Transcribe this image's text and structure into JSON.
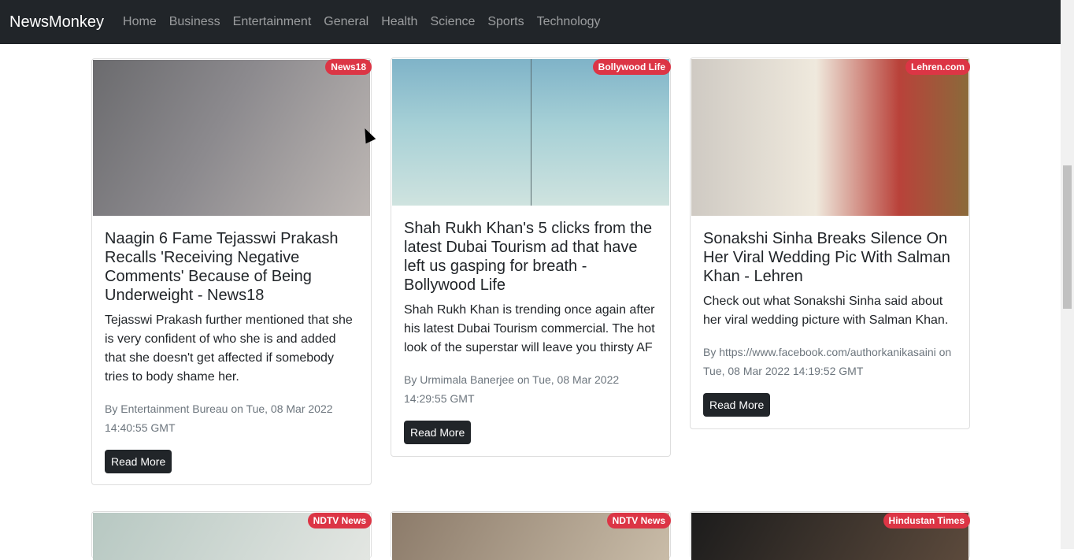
{
  "navbar": {
    "brand": "NewsMonkey",
    "links": [
      "Home",
      "Business",
      "Entertainment",
      "General",
      "Health",
      "Science",
      "Sports",
      "Technology"
    ]
  },
  "cards": [
    {
      "source": "News18",
      "title": "Naagin 6 Fame Tejasswi Prakash Recalls 'Receiving Negative Comments' Because of Being Underweight - News18",
      "description": "Tejasswi Prakash further mentioned that she is very confident of who she is and added that she doesn't get affected if somebody tries to body shame her.",
      "by_label": "By",
      "author": "Entertainment Bureau",
      "on_label": "on",
      "date": "Tue, 08 Mar 2022 14:40:55 GMT",
      "button": "Read More"
    },
    {
      "source": "Bollywood Life",
      "title": "Shah Rukh Khan's 5 clicks from the latest Dubai Tourism ad that have left us gasping for breath - Bollywood Life",
      "description": "Shah Rukh Khan is trending once again after his latest Dubai Tourism commercial. The hot look of the superstar will leave you thirsty AF",
      "by_label": "By",
      "author": "Urmimala Banerjee",
      "on_label": "on",
      "date": "Tue, 08 Mar 2022 14:29:55 GMT",
      "button": "Read More"
    },
    {
      "source": "Lehren.com",
      "title": "Sonakshi Sinha Breaks Silence On Her Viral Wedding Pic With Salman Khan - Lehren",
      "description": "Check out what Sonakshi Sinha said about her viral wedding picture with Salman Khan.",
      "by_label": "By",
      "author": "https://www.facebook.com/authorkanikasaini",
      "on_label": "on",
      "date": "Tue, 08 Mar 2022 14:19:52 GMT",
      "button": "Read More"
    }
  ],
  "next_row_sources": [
    "NDTV News",
    "NDTV News",
    "Hindustan Times"
  ]
}
